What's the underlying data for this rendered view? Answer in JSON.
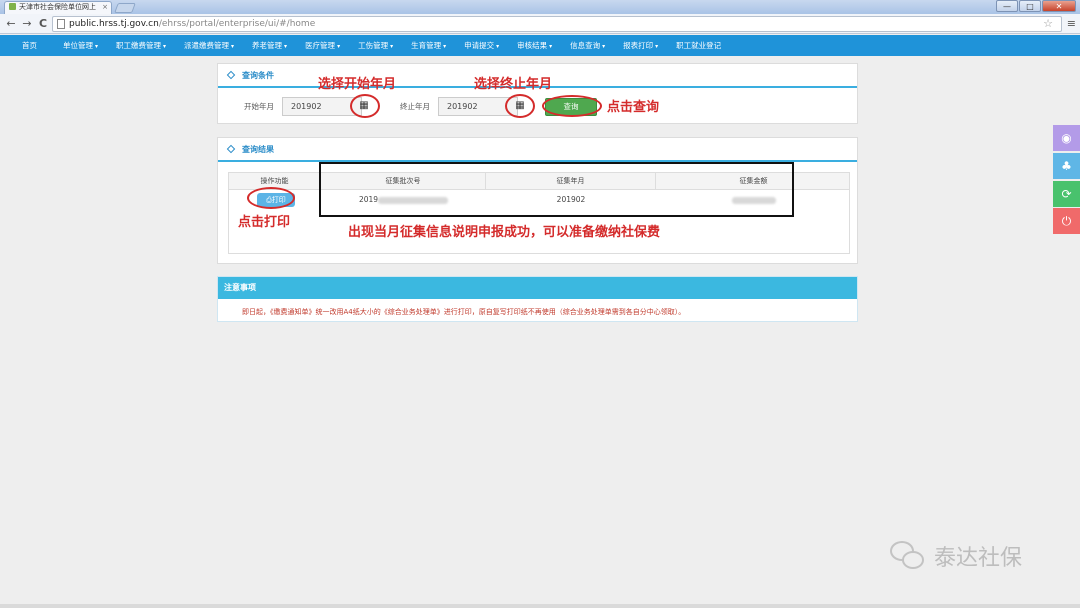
{
  "browser": {
    "tab_title": "天津市社会保险单位网上",
    "tab_close": "×",
    "url_host": "public.hrss.tj.gov.cn",
    "url_path": "/ehrss/portal/enterprise/ui/#/home",
    "back": "←",
    "forward": "→",
    "reload": "C",
    "star": "☆",
    "menu": "≡",
    "window_buttons": {
      "minimize": "—",
      "maximize": "□",
      "close": "✕"
    }
  },
  "nav": {
    "items": [
      {
        "label": "首页",
        "caret": ""
      },
      {
        "label": "单位管理",
        "caret": "▾"
      },
      {
        "label": "职工缴费管理",
        "caret": "▾"
      },
      {
        "label": "派遣缴费管理",
        "caret": "▾"
      },
      {
        "label": "养老管理",
        "caret": "▾"
      },
      {
        "label": "医疗管理",
        "caret": "▾"
      },
      {
        "label": "工伤管理",
        "caret": "▾"
      },
      {
        "label": "生育管理",
        "caret": "▾"
      },
      {
        "label": "申请提交",
        "caret": "▾"
      },
      {
        "label": "审核结果",
        "caret": "▾"
      },
      {
        "label": "信息查询",
        "caret": "▾"
      },
      {
        "label": "报表打印",
        "caret": "▾"
      },
      {
        "label": "职工就业登记",
        "caret": ""
      }
    ]
  },
  "query": {
    "title": "查询条件",
    "start_label": "开始年月",
    "start_value": "201902",
    "end_label": "终止年月",
    "end_value": "201902",
    "calendar_glyph": "▦",
    "button": "查询"
  },
  "results": {
    "title": "查询结果",
    "columns": [
      "操作功能",
      "征集批次号",
      "征集年月",
      "征集金额"
    ],
    "rows": [
      {
        "action": "打印",
        "batch_prefix": "2019",
        "month": "201902"
      }
    ]
  },
  "notice": {
    "title": "注意事项",
    "text": "即日起，《缴费通知单》统一改用A4纸大小的《综合业务处理单》进行打印，原自复写打印纸不再使用（综合业务处理单需到各自分中心领取）。"
  },
  "annotations": {
    "select_start": "选择开始年月",
    "select_end": "选择终止年月",
    "click_query": "点击查询",
    "click_print": "点击打印",
    "success_note": "出现当月征集信息说明申报成功，可以准备缴纳社保费"
  },
  "side_tools": [
    "eye-icon",
    "tree-icon",
    "refresh-icon",
    "power-icon"
  ],
  "side_glyphs": [
    "◉",
    "♣",
    "⟳",
    "⏻"
  ],
  "watermark": {
    "text": "泰达社保"
  },
  "colors": {
    "nav_bg": "#1f93d9",
    "accent": "#2a8cc8",
    "annotation_red": "#d42b2b",
    "query_green": "#4fa84f",
    "notice_head": "#3bb8e0"
  }
}
